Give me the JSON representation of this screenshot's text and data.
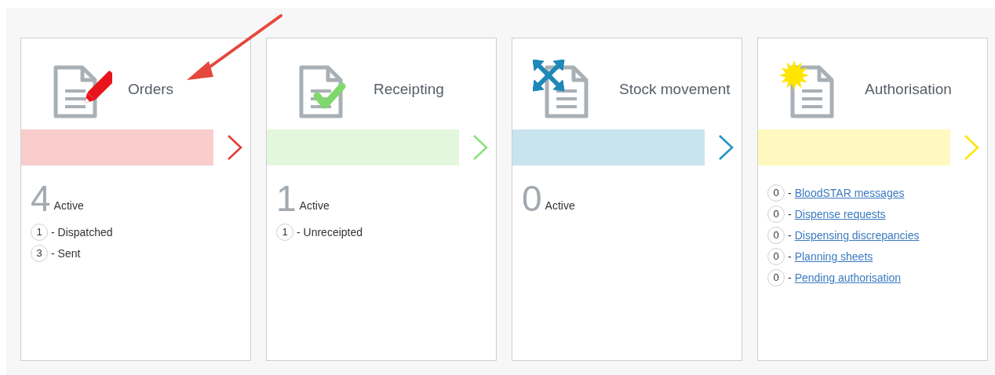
{
  "cards": [
    {
      "title": "Orders",
      "kind": "pencil",
      "color": "#e53935",
      "count": "4",
      "count_label": "Active",
      "items": [
        {
          "kind": "text",
          "count": "1",
          "label": "- Dispatched"
        },
        {
          "kind": "text",
          "count": "3",
          "label": "- Sent"
        }
      ]
    },
    {
      "title": "Receipting",
      "kind": "check",
      "color": "#8ee07c",
      "count": "1",
      "count_label": "Active",
      "items": [
        {
          "kind": "text",
          "count": "1",
          "label": "- Unreceipted"
        }
      ]
    },
    {
      "title": "Stock movement",
      "kind": "move",
      "color": "#1e94c0",
      "count": "0",
      "count_label": "Active"
    },
    {
      "title": "Authorisation",
      "kind": "burst",
      "color": "#ffe500",
      "items": [
        {
          "kind": "link",
          "count": "0",
          "prefix": "-",
          "label": "BloodSTAR messages"
        },
        {
          "kind": "link",
          "count": "0",
          "prefix": "-",
          "label": "Dispense requests"
        },
        {
          "kind": "link",
          "count": "0",
          "prefix": "-",
          "label": "Dispensing discrepancies"
        },
        {
          "kind": "link",
          "count": "0",
          "prefix": "-",
          "label": "Planning sheets"
        },
        {
          "kind": "link",
          "count": "0",
          "prefix": "-",
          "label": "Pending authorisation"
        }
      ]
    }
  ]
}
